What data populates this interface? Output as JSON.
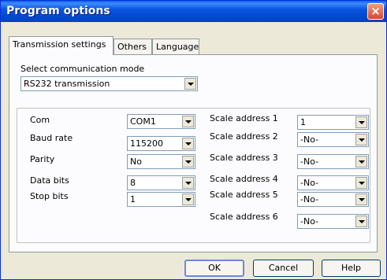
{
  "window": {
    "title": "Program options",
    "close_glyph": "×"
  },
  "tabs": [
    {
      "label": "Transmission settings"
    },
    {
      "label": "Others"
    },
    {
      "label": "Language"
    }
  ],
  "comm_mode": {
    "label": "Select communication mode",
    "value": "RS232 transmission"
  },
  "serial": {
    "com": {
      "label": "Com",
      "value": "COM1"
    },
    "baud": {
      "label": "Baud rate",
      "value": "115200"
    },
    "parity": {
      "label": "Parity",
      "value": "No"
    },
    "data_bits": {
      "label": "Data bits",
      "value": "8"
    },
    "stop_bits": {
      "label": "Stop bits",
      "value": "1"
    }
  },
  "scales": [
    {
      "label": "Scale address 1",
      "value": "1"
    },
    {
      "label": "Scale address 2",
      "value": "-No-"
    },
    {
      "label": "Scale address 3",
      "value": "-No-"
    },
    {
      "label": "Scale address 4",
      "value": "-No-"
    },
    {
      "label": "Scale address 5",
      "value": "-No-"
    },
    {
      "label": "Scale address 6",
      "value": "-No-"
    }
  ],
  "buttons": {
    "ok": "OK",
    "cancel": "Cancel",
    "help": "Help"
  }
}
